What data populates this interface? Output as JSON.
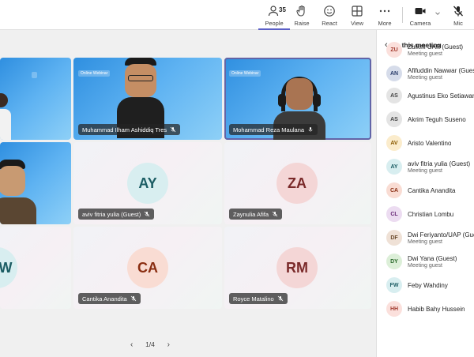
{
  "toolbar": {
    "people": {
      "label": "People",
      "count": "35",
      "icon": "people-icon"
    },
    "raise": {
      "label": "Raise",
      "icon": "hand-icon"
    },
    "react": {
      "label": "React",
      "icon": "smile-icon"
    },
    "view": {
      "label": "View",
      "icon": "grid-icon"
    },
    "more": {
      "label": "More",
      "icon": "more-icon"
    },
    "camera": {
      "label": "Camera",
      "icon": "camera-icon"
    },
    "mic": {
      "label": "Mic",
      "icon": "mic-off-icon"
    }
  },
  "tiles": [
    {
      "type": "video",
      "name": ""
    },
    {
      "type": "video",
      "name": "Muhammad Ilham Ashiddiq Tres",
      "screen": "Online Webinar"
    },
    {
      "type": "video",
      "name": "Mohammad Reza Maulana",
      "screen": "Online Webinar",
      "speaking": true
    },
    {
      "type": "video",
      "name": ""
    },
    {
      "type": "avatar",
      "initials": "AY",
      "name": "aviv fitria yulia (Guest)",
      "bg": "#d8eef0",
      "fg": "#1c5d64"
    },
    {
      "type": "avatar",
      "initials": "ZA",
      "name": "Zaynulia Afifa",
      "bg": "#f4d6d6",
      "fg": "#7a2a2a"
    },
    {
      "type": "avatar",
      "initials": "W",
      "name": "",
      "bg": "#d8eef0",
      "fg": "#1c5d64"
    },
    {
      "type": "avatar",
      "initials": "CA",
      "name": "Cantika Anandita",
      "bg": "#f9dcd3",
      "fg": "#8a2e12"
    },
    {
      "type": "avatar",
      "initials": "RM",
      "name": "Royce Matalino",
      "bg": "#f4d6d6",
      "fg": "#7a2a2a"
    }
  ],
  "pager": {
    "text": "1/4"
  },
  "panel": {
    "title": "In this meeting",
    "participants": [
      {
        "initials": "ZU",
        "name": "Zulkifli UAP (Guest)",
        "sub": "Meeting guest",
        "bg": "#fbe0dc",
        "fg": "#a33a2e"
      },
      {
        "initials": "AN",
        "name": "Afifuddin Nawwar (Guest)",
        "sub": "Meeting guest",
        "bg": "#d6dcea",
        "fg": "#2c3e6b"
      },
      {
        "initials": "AS",
        "name": "Agustinus Eko Setiawan",
        "sub": "",
        "bg": "#e4e4e4",
        "fg": "#444444"
      },
      {
        "initials": "AS",
        "name": "Akrim Teguh Suseno",
        "sub": "",
        "bg": "#e4e4e4",
        "fg": "#444444"
      },
      {
        "initials": "AV",
        "name": "Aristo Valentino",
        "sub": "",
        "bg": "#fbeccc",
        "fg": "#8a5a00"
      },
      {
        "initials": "AY",
        "name": "aviv fitria yulia (Guest)",
        "sub": "Meeting guest",
        "bg": "#d8eef0",
        "fg": "#1c5d64"
      },
      {
        "initials": "CA",
        "name": "Cantika Anandita",
        "sub": "",
        "bg": "#f9dcd3",
        "fg": "#8a2e12"
      },
      {
        "initials": "CL",
        "name": "Christian Lombu",
        "sub": "",
        "bg": "#ecdcf1",
        "fg": "#6b2c7a"
      },
      {
        "initials": "DF",
        "name": "Dwi Feriyanto/UAP (Guest)",
        "sub": "Meeting guest",
        "bg": "#efe1d6",
        "fg": "#6b4a2c"
      },
      {
        "initials": "DY",
        "name": "Dwi Yana (Guest)",
        "sub": "Meeting guest",
        "bg": "#dcefd8",
        "fg": "#2c6b2c"
      },
      {
        "initials": "FW",
        "name": "Feby Wahdiny",
        "sub": "",
        "bg": "#d8eef0",
        "fg": "#1c5d64"
      },
      {
        "initials": "HH",
        "name": "Habib Bahy Hussein",
        "sub": "",
        "bg": "#fbe0dc",
        "fg": "#a33a2e"
      }
    ]
  }
}
